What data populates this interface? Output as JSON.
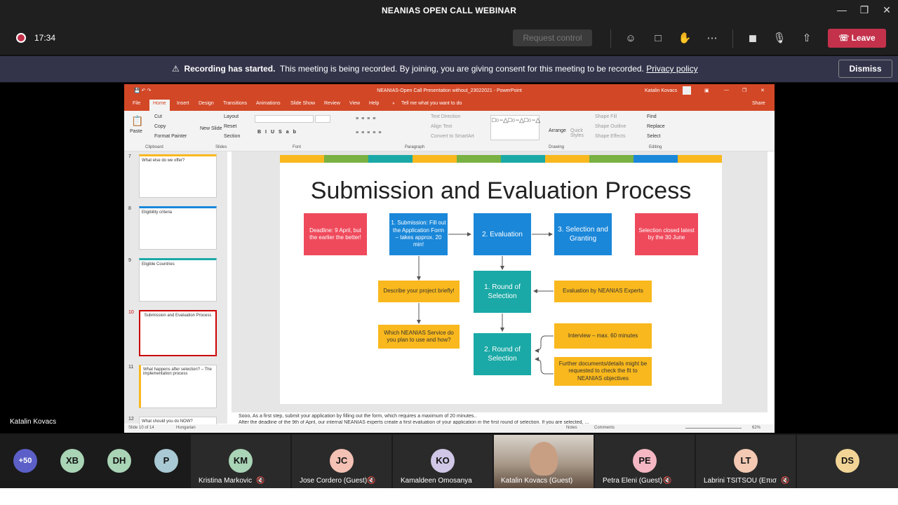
{
  "window": {
    "title": "NEANIAS OPEN CALL WEBINAR"
  },
  "toolbar": {
    "time": "17:34",
    "request_control": "Request control",
    "leave": "Leave"
  },
  "banner": {
    "bold": "Recording has started.",
    "text": "This meeting is being recorded. By joining, you are giving consent for this meeting to be recorded.",
    "link": "Privacy policy",
    "dismiss": "Dismiss"
  },
  "presenter_label": "Katalin Kovacs",
  "ppt": {
    "title": "NEANIAS-Open Call Presentation without_23022021 - PowerPoint",
    "user": "Katalin Kovacs",
    "share": "Share",
    "tabs": [
      "File",
      "Home",
      "Insert",
      "Design",
      "Transitions",
      "Animations",
      "Slide Show",
      "Review",
      "View",
      "Help"
    ],
    "tellme": "Tell me what you want to do",
    "ribbon": {
      "paste": "Paste",
      "cut": "Cut",
      "copy": "Copy",
      "format_painter": "Format Painter",
      "clipboard": "Clipboard",
      "new_slide": "New Slide",
      "layout": "Layout",
      "reset": "Reset",
      "section": "Section",
      "slides": "Slides",
      "font": "Font",
      "paragraph": "Paragraph",
      "text_direction": "Text Direction",
      "align_text": "Align Text",
      "convert": "Convert to SmartArt",
      "drawing": "Drawing",
      "arrange": "Arrange",
      "quick_styles": "Quick Styles",
      "shape_fill": "Shape Fill",
      "shape_outline": "Shape Outline",
      "shape_effects": "Shape Effects",
      "find": "Find",
      "replace": "Replace",
      "select": "Select",
      "editing": "Editing"
    },
    "thumbs": [
      {
        "num": "7",
        "title": "What else do we offer?"
      },
      {
        "num": "8",
        "title": "Eligibility criteria"
      },
      {
        "num": "9",
        "title": "Eligible Countries"
      },
      {
        "num": "10",
        "title": "Submission and Evaluation Process"
      },
      {
        "num": "11",
        "title": "What happens after selection? – The implementation process"
      },
      {
        "num": "12",
        "title": "What should you do NOW?"
      }
    ],
    "slide": {
      "title": "Submission and Evaluation Process",
      "deadline": "Deadline: 9 April, but the earlier the better!",
      "submission": "1. Submission: Fill out the Application Form – takes approx. 20 min!",
      "evaluation": "2. Evaluation",
      "selection": "3. Selection and Granting",
      "closed": "Selection closed latest by the 30 June",
      "describe": "Describe your project briefly!",
      "round1": "1. Round of Selection",
      "experts": "Evaluation by NEANIAS Experts",
      "service": "Which NEANIAS Service do you plan to use and how?",
      "round2": "2. Round of Selection",
      "interview": "Interview – max. 60 minutes",
      "further": "Further documents/details might be requested to check the fit to NEANIAS objectives"
    },
    "notes": "Sooo, As a first step, submit your application by filling out the form, which requires a maximum of 20 minutes..",
    "notes2": "After the deadline of the 9th of April, our internal NEANIAS experts create a first evaluation of your application in the first round of selection. If you are selected, ...",
    "status": {
      "slide": "Slide 10 of 14",
      "lang": "Hungarian",
      "notes": "Notes",
      "comments": "Comments",
      "zoom": "62%"
    }
  },
  "participants": {
    "more": "+50",
    "small": [
      "XB",
      "DH",
      "P"
    ],
    "tiles": [
      {
        "initials": "KM",
        "name": "Kristina Markovic",
        "color": "#a9d4b6"
      },
      {
        "initials": "JC",
        "name": "Jose Cordero (Guest)",
        "color": "#f4c1b5"
      },
      {
        "initials": "KO",
        "name": "Kamaldeen Omosanya",
        "color": "#d0c6e6"
      },
      {
        "initials": "",
        "name": "Katalin Kovacs (Guest)",
        "color": "#8a7a6a"
      },
      {
        "initials": "PE",
        "name": "Petra Eleni (Guest)",
        "color": "#f4b7c3"
      },
      {
        "initials": "LT",
        "name": "Labrini TSITSOU (Επισ...",
        "color": "#f3c9b3"
      },
      {
        "initials": "DS",
        "name": "",
        "color": "#f2d596"
      }
    ]
  },
  "colors": {
    "teams_dark": "#1f1f1f",
    "banner": "#33344a",
    "leave": "#c4314b",
    "ppt_orange": "#d24726"
  }
}
